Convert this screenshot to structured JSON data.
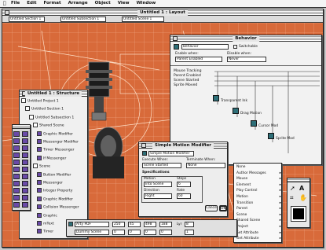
{
  "menubar": {
    "apple": "",
    "items": [
      "File",
      "Edit",
      "Format",
      "Arrange",
      "Object",
      "View",
      "Window"
    ]
  },
  "layout_window": {
    "title": "Untitled 1 : Layout",
    "selectors": [
      "Untitled Section 1",
      "Untitled Subsection 1",
      "Untitled Scene 1"
    ]
  },
  "structure_window": {
    "title": "Untitled 1 : Structure",
    "tree": [
      {
        "label": "Untitled Project 1",
        "indent": 0
      },
      {
        "label": "Untitled Section 1",
        "indent": 1
      },
      {
        "label": "Untitled Subsection 1",
        "indent": 2
      },
      {
        "label": "Shared Scene",
        "indent": 3
      },
      {
        "label": "Graphic Modifier",
        "indent": 4
      },
      {
        "label": "Messenger Modifier",
        "indent": 4
      },
      {
        "label": "Timer Messenger",
        "indent": 4
      },
      {
        "label": "If Messenger",
        "indent": 4
      },
      {
        "label": "Scene",
        "indent": 3
      },
      {
        "label": "Button Modifier",
        "indent": 4
      },
      {
        "label": "Messenger",
        "indent": 4
      },
      {
        "label": "Integer Property",
        "indent": 4
      },
      {
        "label": "Graphic Modifier",
        "indent": 4
      },
      {
        "label": "Collision Messenger",
        "indent": 4
      },
      {
        "label": "Graphic",
        "indent": 4
      },
      {
        "label": "mText",
        "indent": 4
      },
      {
        "label": "Timer",
        "indent": 4
      }
    ]
  },
  "behavior_window": {
    "title": "Behavior",
    "name_field": "Behavior",
    "switchable_label": "Switchable",
    "enable_when_label": "Enable when:",
    "enable_when_value": "Parent Enabled",
    "disable_when_label": "Disable when:",
    "disable_when_value": "Never",
    "events": [
      "Mouse Tracking",
      "Parent Enabled",
      "Scene Started",
      "Sprite Moved"
    ],
    "nodes": [
      "Transparent Ink",
      "Drag Motion",
      "Cursor Mod",
      "Sprite Mod"
    ]
  },
  "motion_window": {
    "title": "Simple Motion Modifier",
    "name_field": "Simple Motion Modifier",
    "execute_when_label": "Execute When:",
    "execute_when_value": "Scene Started",
    "terminate_when_label": "Terminate When:",
    "terminate_when_value": "None",
    "specifications_label": "Specifications",
    "motion_label": "Motion",
    "motion_value": "Into Scene",
    "steps_label": "Steps",
    "steps_value": "6",
    "direction_label": "Direction",
    "direction_value": "Right",
    "rate_label": "Rate",
    "rate_value": "60",
    "cancel_label": "Cancel",
    "ok_label": "OK"
  },
  "context_menu": {
    "items": [
      {
        "label": "None",
        "arrow": false
      },
      {
        "label": "Author Messages",
        "arrow": true
      },
      {
        "label": "Mouse",
        "arrow": true
      },
      {
        "label": "Element",
        "arrow": true
      },
      {
        "label": "Play Control",
        "arrow": true
      },
      {
        "label": "Motion",
        "arrow": true
      },
      {
        "label": "Transition",
        "arrow": true
      },
      {
        "label": "Parent",
        "arrow": true
      },
      {
        "label": "Scene",
        "arrow": true
      },
      {
        "label": "Shared Scene",
        "arrow": true
      },
      {
        "label": "Project",
        "arrow": true
      },
      {
        "label": "Set Attribute",
        "arrow": true
      },
      {
        "label": "Get Attribute",
        "arrow": true
      }
    ]
  },
  "info_bar": {
    "object_name": "Arty PDF",
    "field1": "250",
    "field2": "45",
    "field3": "498",
    "field4": "188",
    "layer_label": "Lyr",
    "layer_value": "8",
    "second_name": "Dummy Scene",
    "field5": "0",
    "field6": "0",
    "field7": "0",
    "field8": "0",
    "field9": "1"
  },
  "colors": {
    "desktop": "#c8c8c8",
    "blueprint": "#d86a3a",
    "tool_purple": "#6a4aa8",
    "node_teal": "#2e6f78"
  }
}
